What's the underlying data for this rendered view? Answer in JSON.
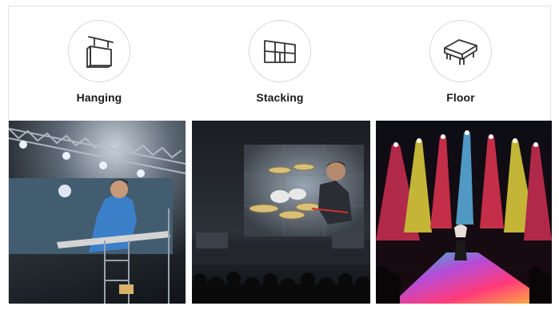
{
  "options": [
    {
      "label": "Hanging",
      "icon": "hanging-sign-icon"
    },
    {
      "label": "Stacking",
      "icon": "stacked-grid-icon"
    },
    {
      "label": "Floor",
      "icon": "floor-platform-icon"
    }
  ],
  "photos": [
    {
      "icon": "hanging-display-concert-photo"
    },
    {
      "icon": "stacking-display-concert-photo"
    },
    {
      "icon": "floor-display-stage-photo"
    }
  ],
  "colors": {
    "border": "#e2e2e2",
    "circle_border": "#d7d7d7",
    "label_text": "#1a1a1a",
    "icon_stroke": "#333333"
  }
}
